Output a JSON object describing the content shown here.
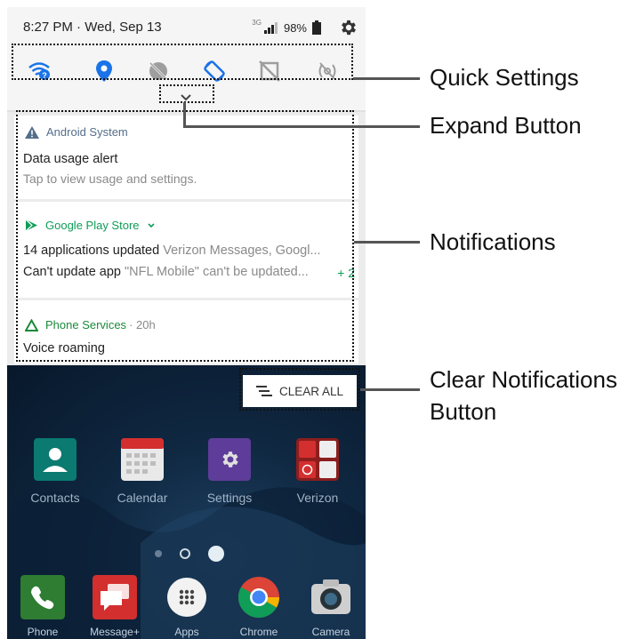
{
  "status_bar": {
    "time_date": "8:27 PM · Wed, Sep 13",
    "network": "3G",
    "battery": "98%"
  },
  "quick_settings": {
    "icons": [
      "wifi-icon",
      "location-icon",
      "do-not-disturb-off-icon",
      "auto-rotate-icon",
      "data-off-icon",
      "nfc-off-icon"
    ]
  },
  "notifications": [
    {
      "app": "Android System",
      "title": "Data usage alert",
      "text": "Tap to view usage and settings."
    },
    {
      "app": "Google Play Store",
      "line1_title": "14 applications updated",
      "line1_text": "Verizon Messages, Googl...",
      "line2_title": "Can't update app",
      "line2_text": "\"NFL Mobile\" can't be updated...",
      "more": "+ 2"
    },
    {
      "app": "Phone Services",
      "time": "· 20h",
      "title": "Voice roaming"
    }
  ],
  "clear_all_label": "CLEAR ALL",
  "home_apps": [
    "Contacts",
    "Calendar",
    "Settings",
    "Verizon"
  ],
  "dock_apps": [
    "Phone",
    "Message+",
    "Apps",
    "Chrome",
    "Camera"
  ],
  "colors": {
    "accent_blue": "#1a73e8",
    "play_green": "#0f9d58",
    "phone_services_green": "#1b8a3a"
  },
  "callouts": {
    "quick_settings": "Quick Settings",
    "expand_button": "Expand Button",
    "notifications": "Notifications",
    "clear_line1": "Clear Notifications",
    "clear_line2": "Button"
  }
}
